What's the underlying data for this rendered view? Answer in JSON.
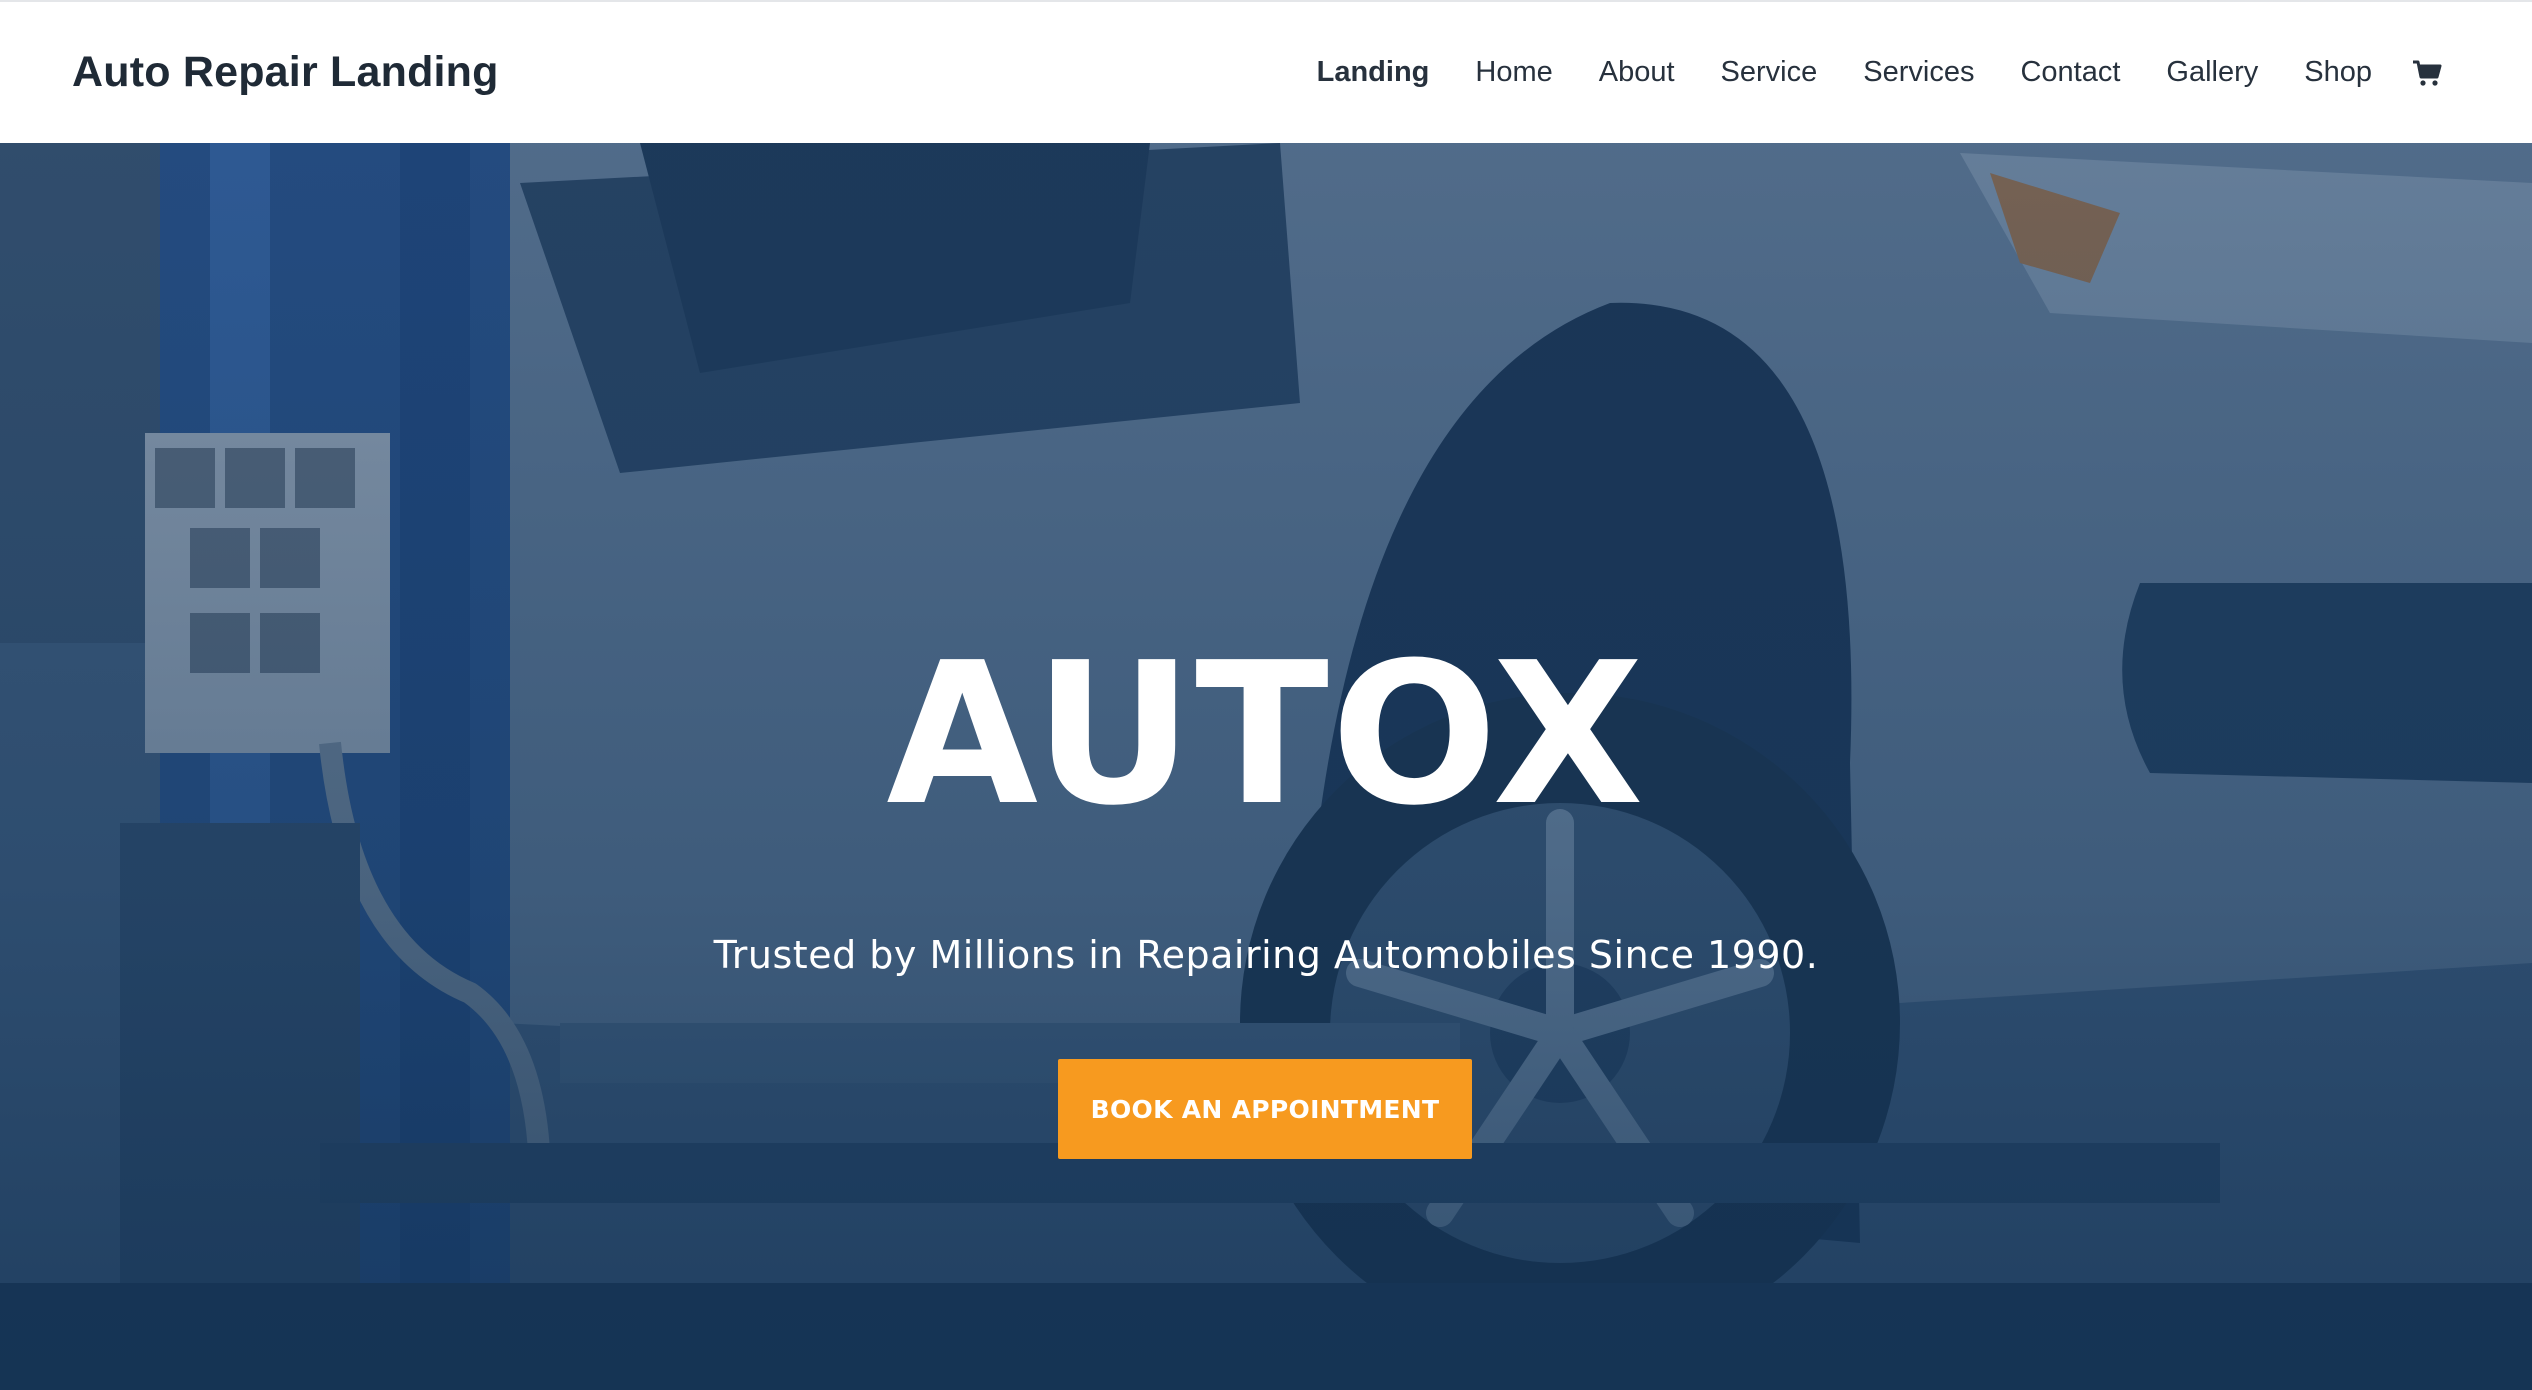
{
  "site": {
    "title": "Auto Repair Landing"
  },
  "nav": {
    "items": [
      {
        "label": "Landing",
        "active": true
      },
      {
        "label": "Home"
      },
      {
        "label": "About"
      },
      {
        "label": "Service"
      },
      {
        "label": "Services"
      },
      {
        "label": "Contact"
      },
      {
        "label": "Gallery"
      },
      {
        "label": "Shop"
      }
    ],
    "cart_icon": "shopping-cart-icon"
  },
  "hero": {
    "title": "AUTOX",
    "subtitle": "Trusted by Millions in Repairing Automobiles Since 1990.",
    "cta_label": "BOOK AN APPOINTMENT",
    "background_image": "car-on-lift-photo"
  },
  "colors": {
    "header_bg": "#ffffff",
    "header_text": "#1f2a36",
    "hero_overlay": "#1d4468",
    "cta_bg": "#f79a1f",
    "cta_text": "#ffffff"
  }
}
